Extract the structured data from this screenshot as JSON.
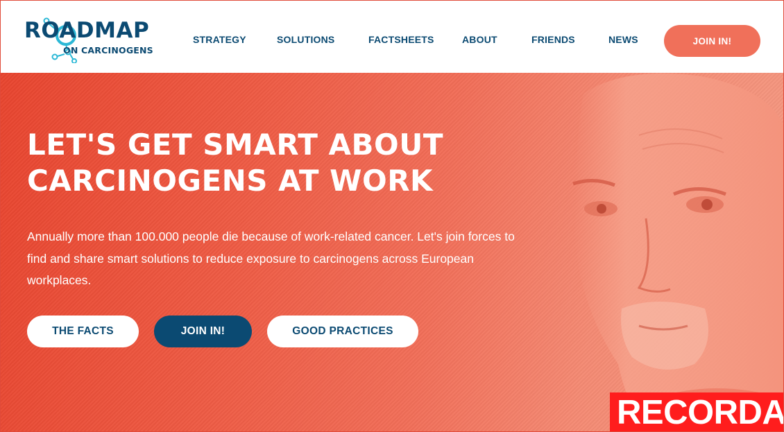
{
  "logo": {
    "title": "ROADMAP",
    "subtitle": "ON CARCINOGENS"
  },
  "nav": {
    "items": [
      {
        "label": "STRATEGY"
      },
      {
        "label": "SOLUTIONS"
      },
      {
        "label": "FACTSHEETS"
      },
      {
        "label": "ABOUT"
      },
      {
        "label": "FRIENDS"
      },
      {
        "label": "NEWS"
      }
    ],
    "cta_label": "JOIN IN!"
  },
  "hero": {
    "title_line1": "LET'S GET SMART ABOUT",
    "title_line2": "CARCINOGENS AT WORK",
    "text": "Annually more than 100.000 people die because of work-related cancer. Let's join forces to find and share smart solutions to reduce exposure to carcinogens across European workplaces.",
    "buttons": {
      "facts": "THE FACTS",
      "join": "JOIN IN!",
      "good_practices": "GOOD PRACTICES"
    }
  },
  "overlay": {
    "record_label": "RECORDA"
  },
  "colors": {
    "brand_blue": "#0b4a72",
    "accent_coral": "#f0705a",
    "hero_red": "#e8452f",
    "record_red": "#ff1d1d"
  },
  "icons": [
    "molecule-dots-icon",
    "portrait-image"
  ]
}
